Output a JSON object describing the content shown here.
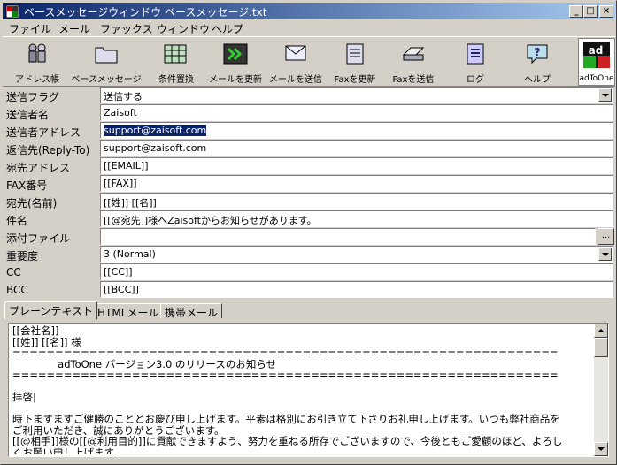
{
  "window": {
    "title": "ベースメッセージウィンドウ ベースメッセージ.txt",
    "minimize": "_",
    "maximize": "□",
    "close": "×"
  },
  "menu": [
    "ファイル",
    "メール",
    "ファックス",
    "ウィンドウ",
    "ヘルプ"
  ],
  "toolbar": {
    "buttons": [
      {
        "label": "アドレス帳",
        "icon": "address-book-icon"
      },
      {
        "label": "ベースメッセージ",
        "icon": "folder-icon"
      },
      {
        "label": "条件置換",
        "icon": "table-grid-icon"
      },
      {
        "label": "メールを更新",
        "icon": "refresh-mail-icon"
      },
      {
        "label": "メールを送信",
        "icon": "send-mail-icon"
      },
      {
        "label": "Faxを更新",
        "icon": "fax-document-icon"
      },
      {
        "label": "Faxを送信",
        "icon": "fax-machine-icon"
      },
      {
        "label": "ログ",
        "icon": "log-icon"
      },
      {
        "label": "ヘルプ",
        "icon": "help-icon"
      }
    ],
    "brand_label": "adToOne",
    "brand_logo_text": "ad"
  },
  "fields": {
    "send_flag": {
      "label": "送信フラグ",
      "value": "送信する"
    },
    "sender_name": {
      "label": "送信者名",
      "value": "Zaisoft"
    },
    "sender_address": {
      "label": "送信者アドレス",
      "value": "support@zaisoft.com"
    },
    "reply_to": {
      "label": "返信先(Reply-To)",
      "value": "support@zaisoft.com"
    },
    "to_address": {
      "label": "宛先アドレス",
      "value": "[[EMAIL]]"
    },
    "fax_number": {
      "label": "FAX番号",
      "value": "[[FAX]]"
    },
    "to_name": {
      "label": "宛先(名前)",
      "value": "[[姓]] [[名]]"
    },
    "subject": {
      "label": "件名",
      "value": "[[@宛先]]様へZaisoftからお知らせがあります。"
    },
    "attachment": {
      "label": "添付ファイル",
      "value": "",
      "browse": "..."
    },
    "priority": {
      "label": "重要度",
      "value": "3 (Normal)"
    },
    "cc": {
      "label": "CC",
      "value": "[[CC]]"
    },
    "bcc": {
      "label": "BCC",
      "value": "[[BCC]]"
    }
  },
  "tabs": [
    "プレーンテキスト",
    "HTMLメール",
    "携帯メール"
  ],
  "body_text": "[[会社名]]\n[[姓]] [[名]] 様\n================================================================\n              adToOne バージョン3.0 のリリースのお知らせ\n================================================================\n\n拝啓|\n\n時下ますますご健勝のこととお慶び申し上げます。平素は格別にお引き立て下さりお礼申し上げます。いつも弊社商品を\nご利用いただき、誠にありがとうございます。\n[[@相手]]様の[[@利用目的]]に貢献できますよう、努力を重ねる所存でございますので、今後ともご愛顧のほど、よろし\nくお願い申し上げます。"
}
